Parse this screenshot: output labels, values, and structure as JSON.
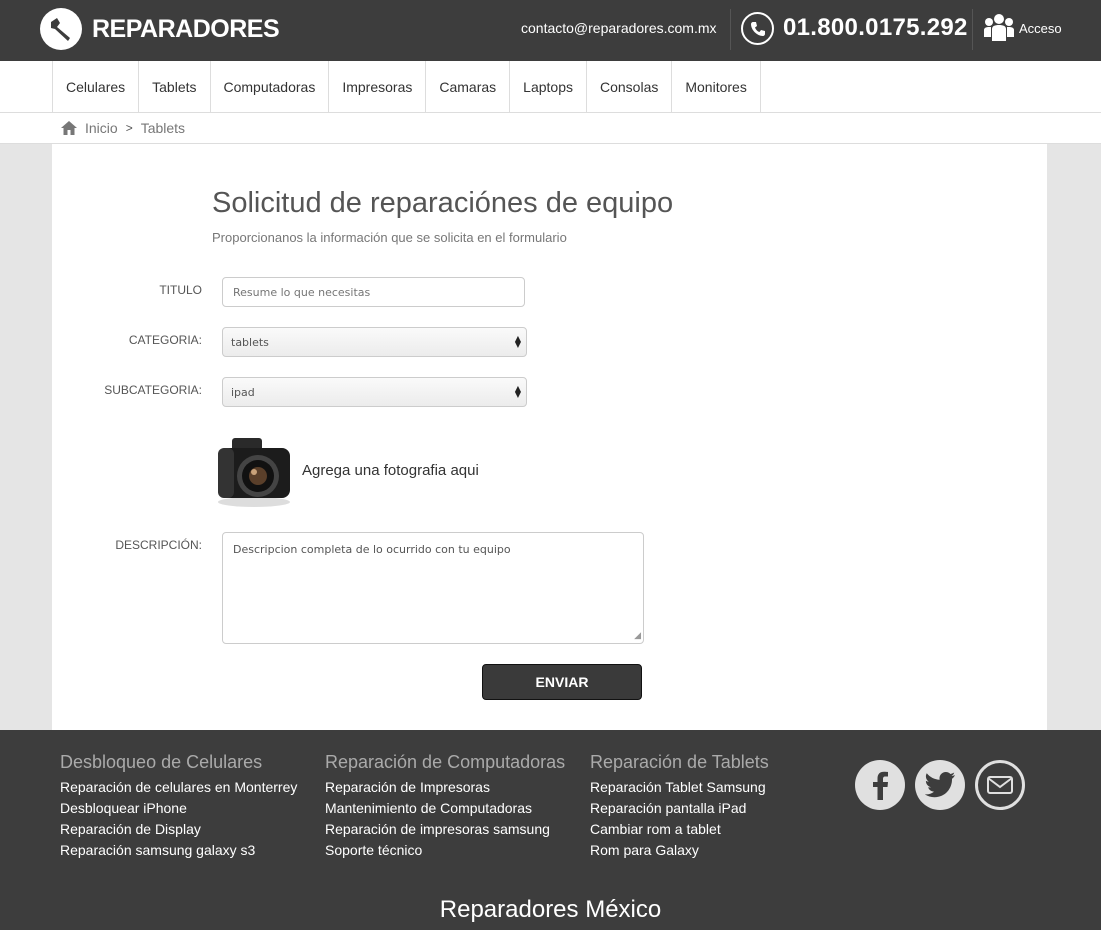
{
  "header": {
    "brand": "REPARADORES",
    "email": "contacto@reparadores.com.mx",
    "phone": "01.800.0175.292",
    "access_label": "Acceso"
  },
  "nav": {
    "items": [
      "Celulares",
      "Tablets",
      "Computadoras",
      "Impresoras",
      "Camaras",
      "Laptops",
      "Consolas",
      "Monitores"
    ]
  },
  "breadcrumb": {
    "home": "Inicio",
    "separator": ">",
    "current": "Tablets"
  },
  "form": {
    "title": "Solicitud de reparaciónes de equipo",
    "subtitle": "Proporcionanos la información que se solicita en el formulario",
    "titulo_label": "TITULO",
    "titulo_placeholder": "Resume lo que necesitas",
    "categoria_label": "CATEGORIA:",
    "categoria_value": "tablets",
    "subcategoria_label": "SUBCATEGORIA:",
    "subcategoria_value": "ipad",
    "photo_label": "Agrega una fotografia aqui",
    "descripcion_label": "DESCRIPCIÓN:",
    "descripcion_placeholder": "Descripcion completa de lo ocurrido con tu equipo",
    "submit_label": "ENVIAR"
  },
  "footer": {
    "columns": [
      {
        "heading": "Desbloqueo de Celulares",
        "links": [
          "Reparación de celulares en Monterrey",
          "Desbloquear iPhone",
          "Reparación de Display",
          "Reparación samsung galaxy s3"
        ]
      },
      {
        "heading": "Reparación de Computadoras",
        "links": [
          "Reparación de Impresoras",
          "Mantenimiento de Computadoras",
          "Reparación de impresoras samsung",
          "Soporte técnico"
        ]
      },
      {
        "heading": "Reparación de Tablets",
        "links": [
          "Reparación Tablet Samsung",
          "Reparación pantalla iPad",
          "Cambiar rom a tablet",
          "Rom para Galaxy"
        ]
      }
    ],
    "social": [
      "facebook-icon",
      "twitter-icon",
      "mail-icon"
    ],
    "brand": "Reparadores México"
  },
  "colors": {
    "header_bg": "#3d3d3d",
    "page_bg": "#e5e5e5",
    "button_bg": "#3a3a3a"
  }
}
